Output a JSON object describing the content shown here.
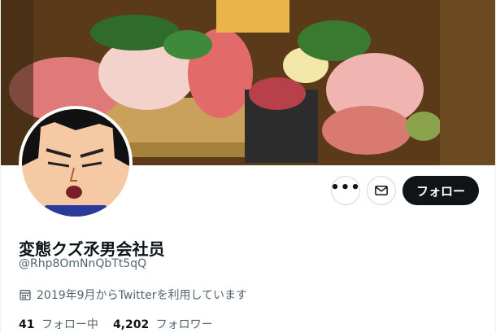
{
  "profile": {
    "display_name": "変態クズ氶男会社员",
    "handle": "@Rhp8OmNnQbTt5qQ",
    "joined": "2019年9月からTwitterを利用しています",
    "following_count": "41",
    "following_label": "フォロー中",
    "followers_count": "4,202",
    "followers_label": "フォロワー"
  },
  "actions": {
    "more_label": "•••",
    "follow_label": "フォロー"
  },
  "icons": {
    "more": "more-icon",
    "mail": "mail-icon",
    "calendar": "calendar-icon"
  },
  "colors": {
    "follow_button_bg": "#0f1419",
    "secondary_text": "#536471",
    "border": "#cfd9de"
  }
}
